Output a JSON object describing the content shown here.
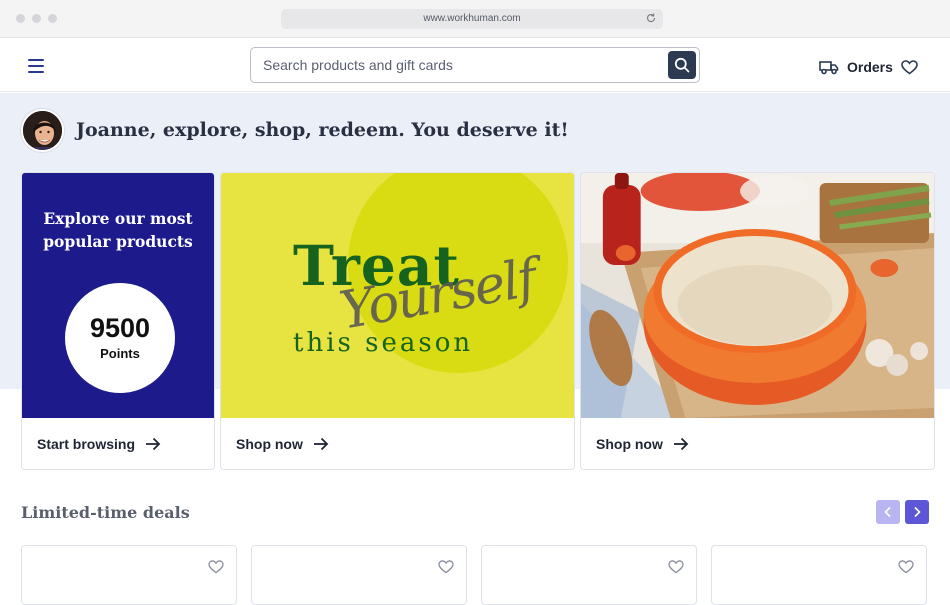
{
  "browser": {
    "url": "www.workhuman.com"
  },
  "header": {
    "search_placeholder": "Search products and gift cards",
    "orders_label": "Orders"
  },
  "greeting": "Joanne, explore, shop, redeem. You deserve it!",
  "cards": [
    {
      "title": "Explore our most popular products",
      "points_value": "9500",
      "points_label": "Points",
      "cta": "Start browsing"
    },
    {
      "headline": "Treat",
      "script": "Yourself",
      "subline": "this season",
      "cta": "Shop now"
    },
    {
      "cta": "Shop now"
    }
  ],
  "deals": {
    "title": "Limited-time deals"
  },
  "colors": {
    "promo_bg": "#1d1a8c",
    "treat_bg": "#e7e341",
    "treat_text": "#15631f",
    "nav_active": "#5d57d8",
    "nav_inactive": "#b8b5f1",
    "band_bg": "#eaeff8"
  },
  "icons": [
    "menu-icon",
    "search-icon",
    "refresh-icon",
    "truck-icon",
    "heart-icon",
    "arrow-right-icon",
    "chevron-left-icon",
    "chevron-right-icon"
  ]
}
